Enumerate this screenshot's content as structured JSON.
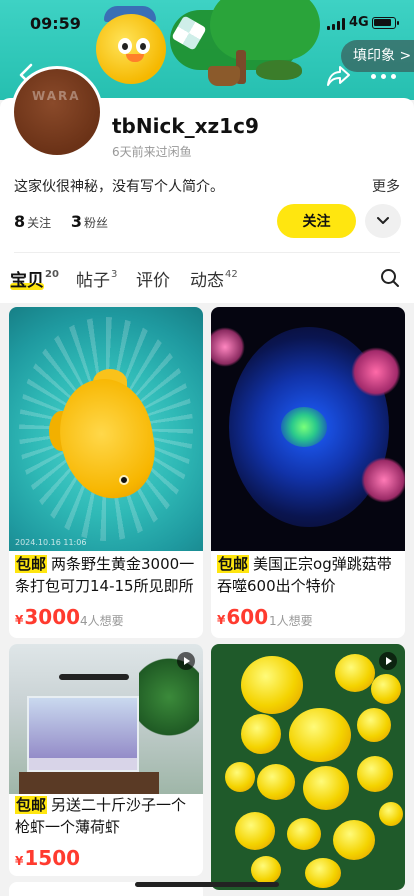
{
  "status_bar": {
    "time": "09:59",
    "network": "4G"
  },
  "header": {
    "fill_badge": "填印象 >"
  },
  "profile": {
    "username": "tbNick_xz1c9",
    "last_seen": "6天前来过闲鱼",
    "bio": "这家伙很神秘，没有写个人简介。",
    "more_label": "更多",
    "following_count": "8",
    "following_label": "关注",
    "followers_count": "3",
    "followers_label": "粉丝",
    "follow_button": "关注"
  },
  "tabs": [
    {
      "label": "宝贝",
      "count": "20"
    },
    {
      "label": "帖子",
      "count": "3"
    },
    {
      "label": "评价",
      "count": ""
    },
    {
      "label": "动态",
      "count": "42"
    }
  ],
  "items": [
    {
      "tag": "包邮",
      "title": "两条野生黄金3000一条打包可刀14-15所见即所",
      "currency": "¥",
      "price": "3000",
      "want": "4人想要",
      "image_stamp": "2024.10.16 11:06"
    },
    {
      "tag": "包邮",
      "title": "美国正宗og弹跳菇带吞噬600出个特价",
      "currency": "¥",
      "price": "600",
      "want": "1人想要"
    },
    {
      "tag": "包邮",
      "title": "另送二十斤沙子一个枪虾一个薄荷虾",
      "currency": "¥",
      "price": "1500",
      "want": ""
    }
  ],
  "colors": {
    "accent": "#ffe60f",
    "price": "#ff3b2f",
    "banner": "#2fc7b8"
  }
}
